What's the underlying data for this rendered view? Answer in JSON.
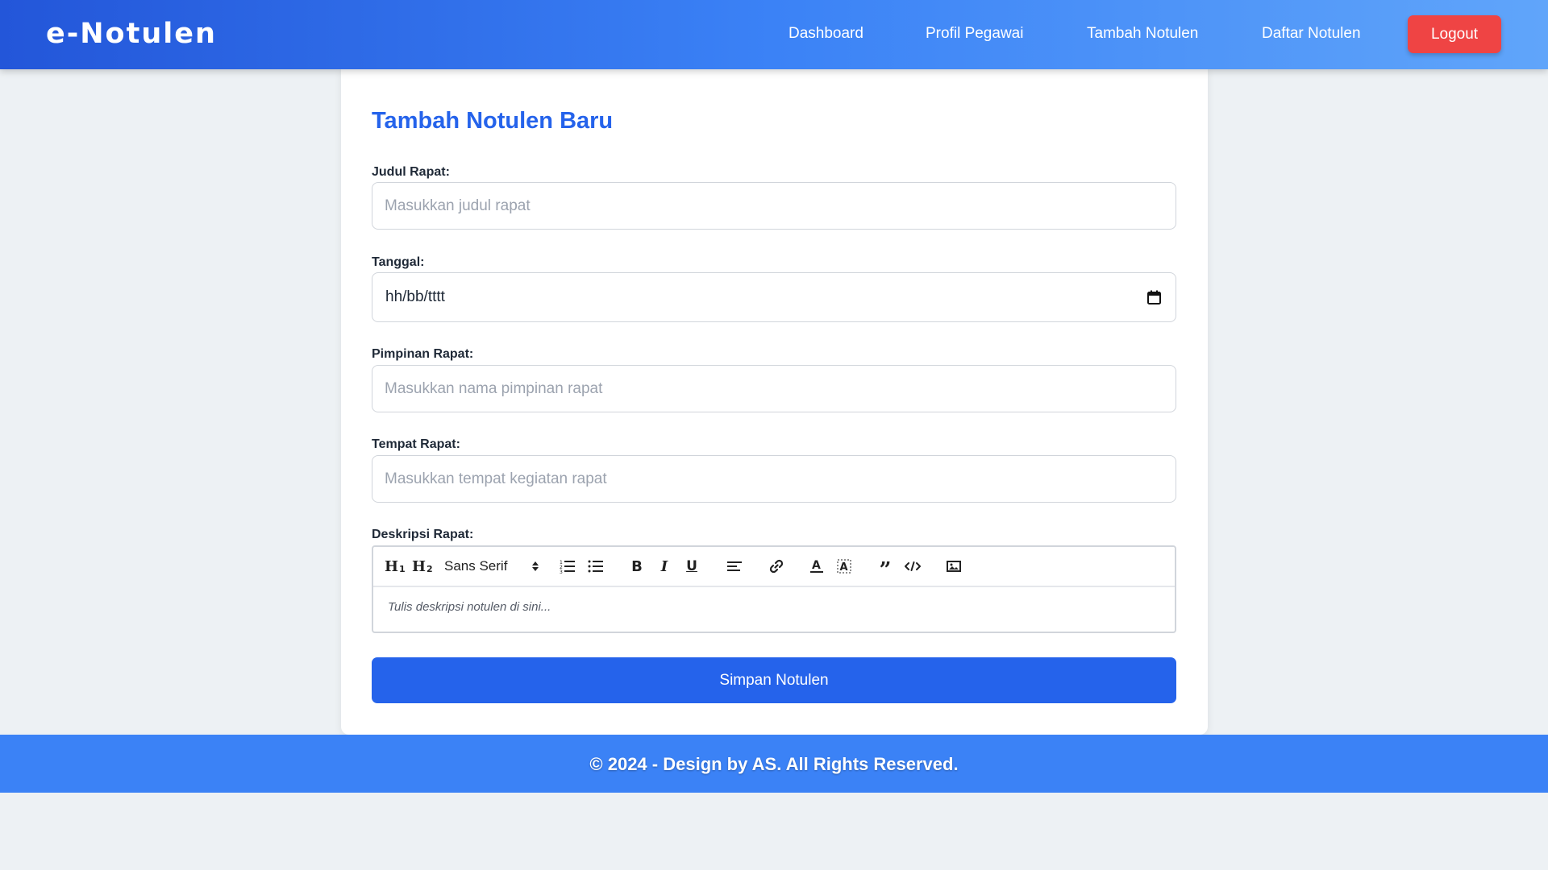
{
  "app": {
    "brand": "e-Notulen"
  },
  "nav": {
    "items": [
      {
        "label": "Dashboard"
      },
      {
        "label": "Profil Pegawai"
      },
      {
        "label": "Tambah Notulen"
      },
      {
        "label": "Daftar Notulen"
      }
    ],
    "logout_label": "Logout"
  },
  "form": {
    "title": "Tambah Notulen Baru",
    "judul": {
      "label": "Judul Rapat:",
      "placeholder": "Masukkan judul rapat",
      "value": ""
    },
    "tanggal": {
      "label": "Tanggal:",
      "value": "hh/bb/tttt"
    },
    "pimpinan": {
      "label": "Pimpinan Rapat:",
      "placeholder": "Masukkan nama pimpinan rapat",
      "value": ""
    },
    "tempat": {
      "label": "Tempat Rapat:",
      "placeholder": "Masukkan tempat kegiatan rapat",
      "value": ""
    },
    "deskripsi": {
      "label": "Deskripsi Rapat:",
      "font_selected": "Sans Serif",
      "placeholder": "Tulis deskripsi notulen di sini...",
      "toolbar_icons": [
        "heading1-icon",
        "heading2-icon",
        "ordered-list-icon",
        "bullet-list-icon",
        "bold-icon",
        "italic-icon",
        "underline-icon",
        "align-icon",
        "link-icon",
        "text-color-icon",
        "background-color-icon",
        "blockquote-icon",
        "code-block-icon",
        "image-icon"
      ]
    },
    "submit_label": "Simpan Notulen"
  },
  "footer": {
    "text": "© 2024 - Design by AS. All Rights Reserved."
  },
  "colors": {
    "navbar_start": "#2356d9",
    "navbar_end": "#60a5fa",
    "accent": "#2563eb",
    "logout": "#ef4444",
    "footer": "#3b82f6",
    "page_bg": "#edf1f4"
  }
}
